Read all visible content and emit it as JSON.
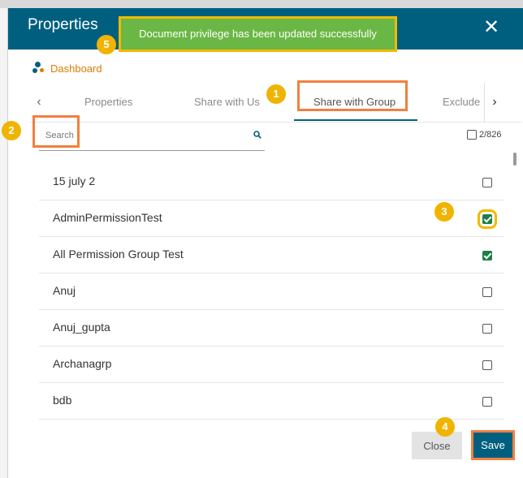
{
  "modal": {
    "title": "Properties",
    "close_icon": "close-icon",
    "close_glyph": "✕"
  },
  "toast": {
    "message": "Document privilege has been updated successfully",
    "color": "#6bb745"
  },
  "breadcrumb": {
    "label": "Dashboard",
    "icon": "dashboard-icon"
  },
  "tabs": {
    "prev_glyph": "‹",
    "next_glyph": "›",
    "items": [
      {
        "label": "Properties"
      },
      {
        "label": "Share with Us"
      },
      {
        "label": "Share with Group"
      },
      {
        "label": "Exclude"
      }
    ],
    "active_index": 2
  },
  "search": {
    "placeholder": "Search",
    "value": ""
  },
  "selection": {
    "count_text": "2/826"
  },
  "groups": [
    {
      "name": "15 july 2",
      "checked": false
    },
    {
      "name": "AdminPermissionTest",
      "checked": true
    },
    {
      "name": "All Permission Group Test",
      "checked": true
    },
    {
      "name": "Anuj",
      "checked": false
    },
    {
      "name": "Anuj_gupta",
      "checked": false
    },
    {
      "name": "Archanagrp",
      "checked": false
    },
    {
      "name": "bdb",
      "checked": false
    }
  ],
  "footer": {
    "close_label": "Close",
    "save_label": "Save"
  },
  "steps": {
    "one": "1",
    "two": "2",
    "three": "3",
    "four": "4",
    "five": "5"
  },
  "colors": {
    "header": "#005f7f",
    "accent_orange": "#e07b00",
    "step_badge": "#f0b400",
    "highlight_border": "#f08040",
    "checkbox_checked": "#1e7e45"
  }
}
